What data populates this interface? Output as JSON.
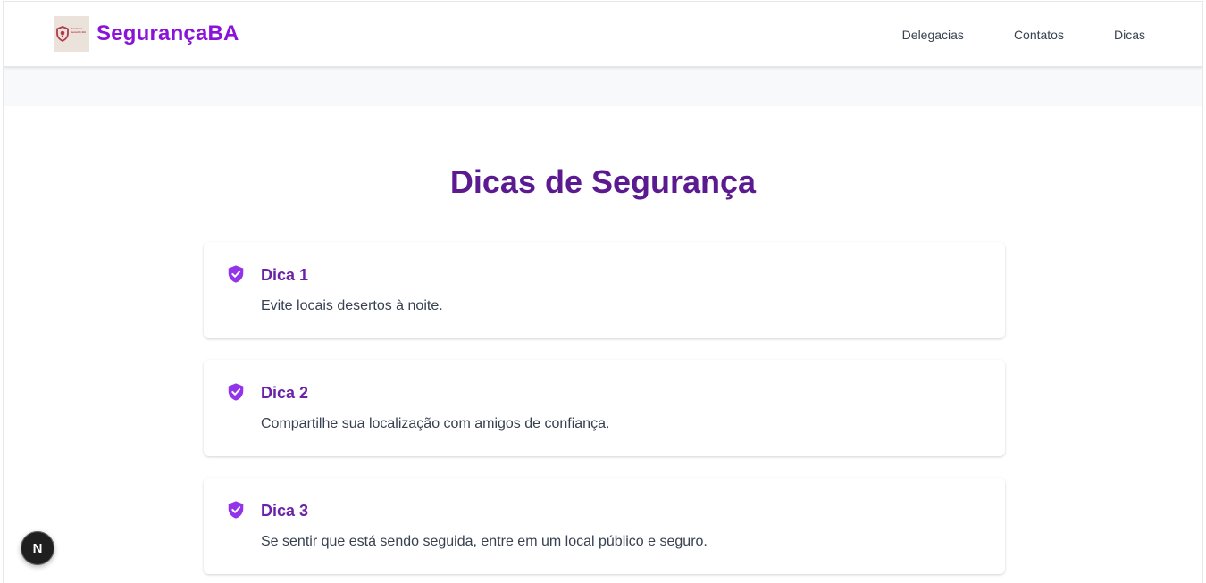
{
  "navbar": {
    "brand_name": "SegurançaBA",
    "logo_text": "Business Security BA",
    "links": [
      "Delegacias",
      "Contatos",
      "Dicas"
    ]
  },
  "main": {
    "title": "Dicas de Segurança",
    "tips": [
      {
        "title": "Dica 1",
        "text": "Evite locais desertos à noite."
      },
      {
        "title": "Dica 2",
        "text": "Compartilhe sua localização com amigos de confiança."
      },
      {
        "title": "Dica 3",
        "text": "Se sentir que está sendo seguida, entre em um local público e seguro."
      }
    ]
  },
  "dev_badge": {
    "label": "N"
  },
  "colors": {
    "brand": "#8b12d9",
    "title": "#5b1a8f",
    "card_title": "#6b21a8",
    "icon": "#9333ea"
  },
  "icons": {
    "tip_icon": "shield-check-icon",
    "logo": "shield-logo-icon"
  }
}
